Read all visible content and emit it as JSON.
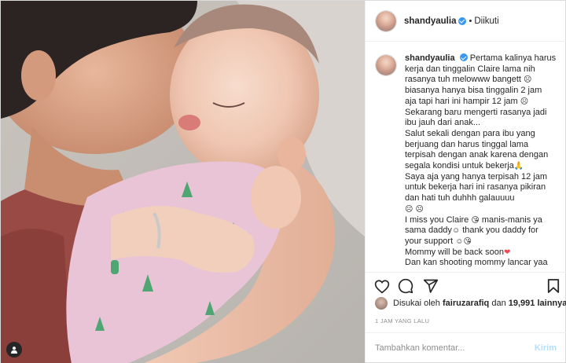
{
  "post": {
    "username": "shandyaulia",
    "follow_state": "Diikuti",
    "separator": "•",
    "caption_lines": [
      "Pertama kalinya harus",
      "kerja dan tinggalin Claire lama nih",
      "rasanya tuh melowww bangett",
      "biasanya hanya bisa tinggalin 2 jam",
      "aja tapi hari ini hampir 12 jam",
      "Sekarang baru mengerti rasanya jadi",
      "ibu jauh dari anak...",
      "Salut sekali dengan para ibu yang",
      "berjuang dan harus tinggal lama",
      "terpisah dengan anak karena dengan",
      "segala kondisi untuk bekerja",
      "Saya aja yang hanya terpisah 12 jam",
      "untuk bekerja hari ini rasanya pikiran",
      "dan hati tuh duhhh galauuuu",
      "",
      "I miss you Claire",
      "sama daddy",
      "your support",
      "Mommy will be back soon",
      "Dan kan shooting mommy lancar yaa"
    ],
    "caption_extras": {
      "line16_after": "manis-manis ya",
      "line17_after": "thank you daddy for"
    },
    "emoji": {
      "sad": "☹",
      "pray": "🙏",
      "smile": "☺",
      "heart": "❤",
      "kiss": "😘"
    },
    "likes": {
      "prefix": "Disukai oleh",
      "user": "fairuzarafiq",
      "middle": "dan",
      "count": "19,991",
      "suffix": "lainnya"
    },
    "timestamp": "1 JAM YANG LALU",
    "comment_placeholder": "Tambahkan komentar...",
    "send_label": "Kirim"
  },
  "colors": {
    "verified": "#3897f0",
    "send_disabled": "#b2dffc",
    "heart": "#ed4956"
  },
  "icons": [
    "verified-icon",
    "heart-icon",
    "comment-icon",
    "share-icon",
    "bookmark-icon",
    "user-tag-icon"
  ]
}
